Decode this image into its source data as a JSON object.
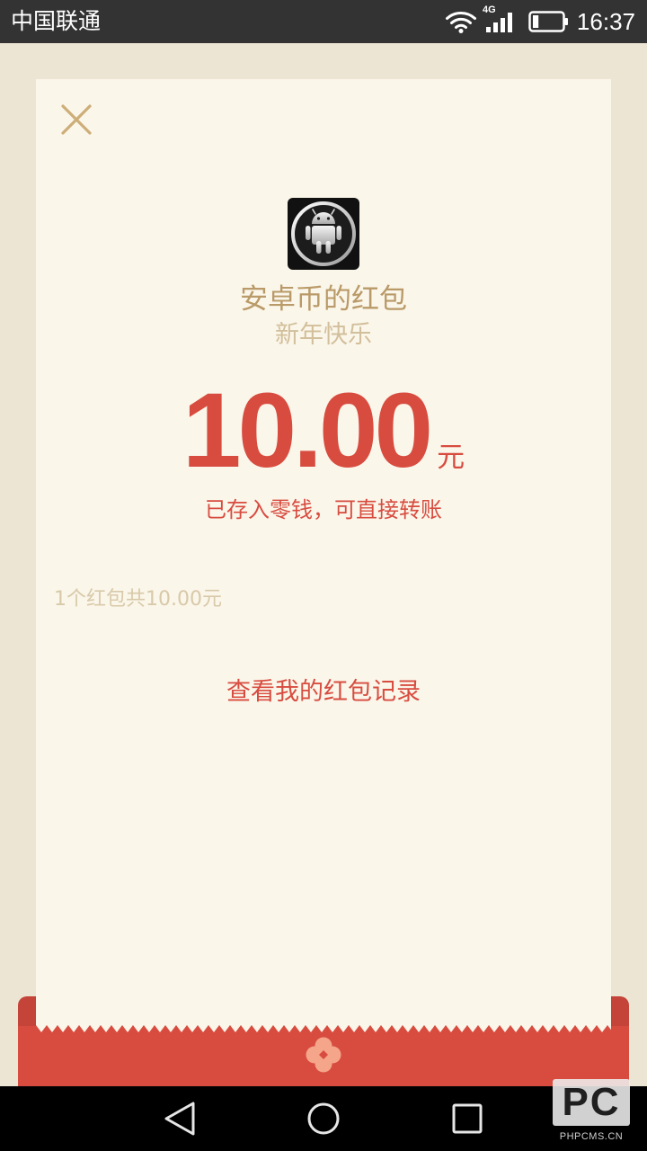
{
  "status_bar": {
    "carrier": "中国联通",
    "network_type": "4G",
    "time": "16:37",
    "battery_level": 0.2,
    "icons": {
      "wifi": "wifi-icon",
      "signal": "signal-icon",
      "battery": "battery-icon"
    }
  },
  "packet": {
    "close_icon": "close-icon",
    "avatar_icon": "android-logo-icon",
    "sender_title": "安卓币的红包",
    "greeting": "新年快乐",
    "amount": "10.00",
    "currency_unit": "元",
    "deposit_note": "已存入零钱，可直接转账",
    "summary": "1个红包共10.00元",
    "records_link": "查看我的红包记录",
    "envelope_icon": "flower-icon"
  },
  "nav_bar": {
    "back_icon": "back-icon",
    "home_icon": "home-icon",
    "recents_icon": "recents-icon"
  },
  "watermark": {
    "logo_text": "PC",
    "site": "PHPCMS.CN"
  },
  "colors": {
    "status_bar": "#333333",
    "page_background": "#EDE5D3",
    "card": "#FBF6EA",
    "accent_red": "#D84C40",
    "envelope_dark_red": "#C4443A",
    "title_tan": "#B99A68",
    "subtitle_tan": "#D2BF9B",
    "summary_tan": "#D8C9A9",
    "close_tan": "#CDAE78",
    "flower": "#F4A58A",
    "nav_bar": "#000000"
  }
}
